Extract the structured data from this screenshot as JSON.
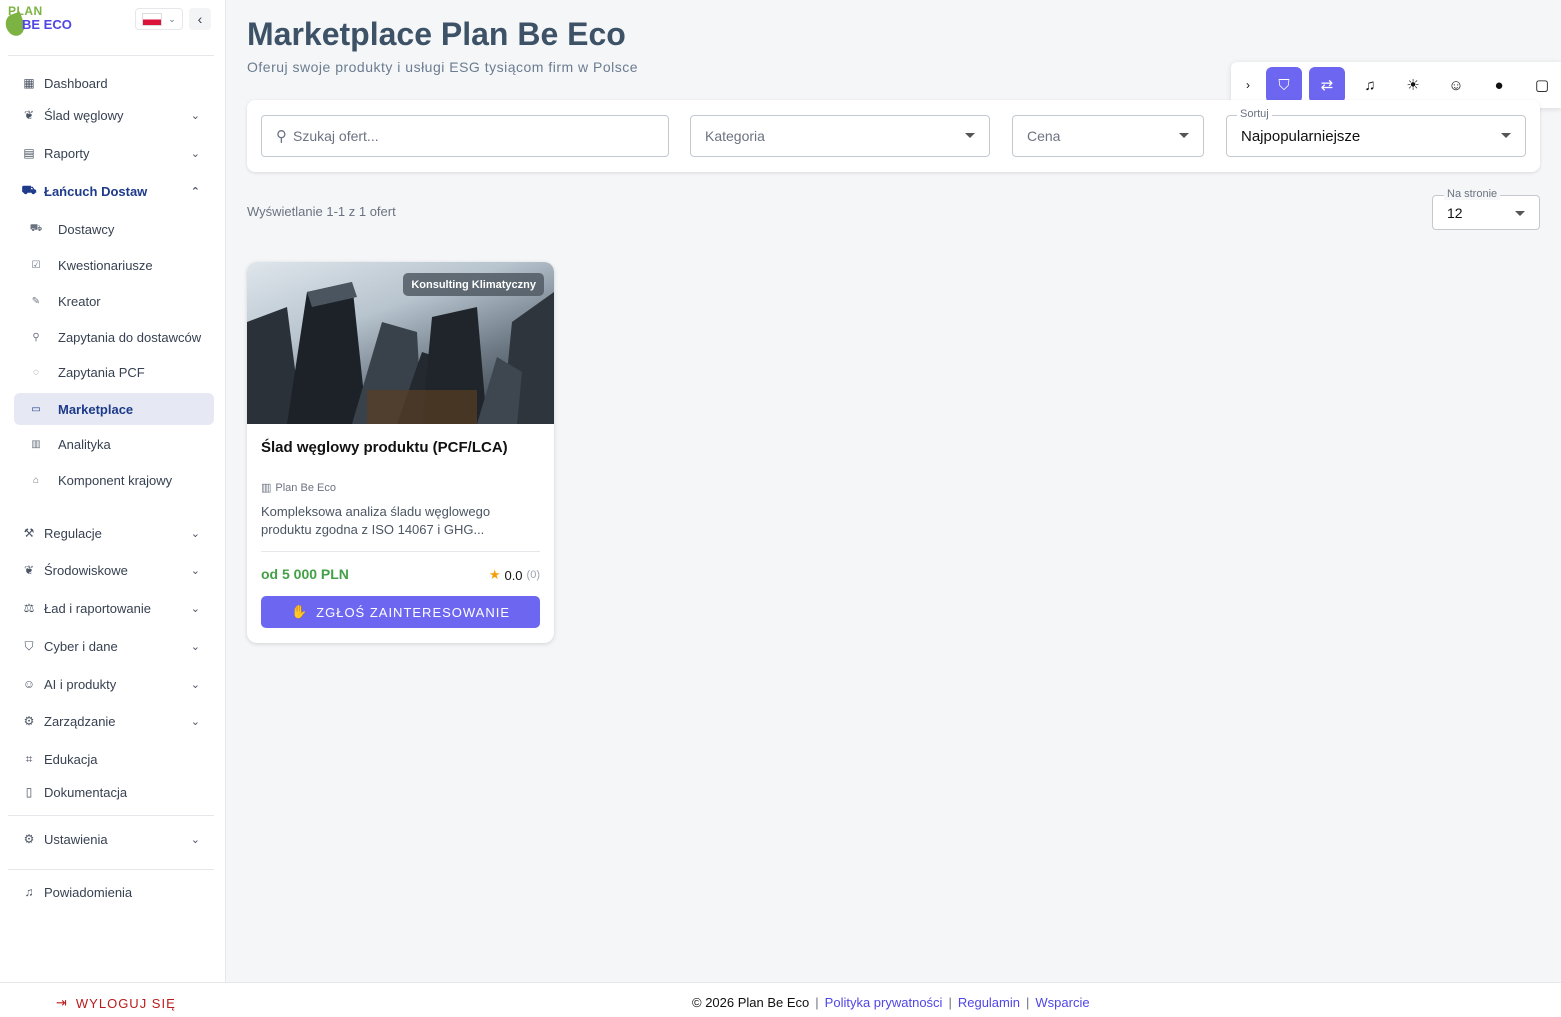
{
  "brand": {
    "line1": "PLAN",
    "line2": "BE ECO"
  },
  "sidebar": {
    "items": [
      {
        "icon": "dashboard-icon",
        "label": "Dashboard"
      },
      {
        "icon": "leaf-icon",
        "label": "Ślad węglowy"
      },
      {
        "icon": "report-icon",
        "label": "Raporty"
      },
      {
        "icon": "truck-icon",
        "label": "Łańcuch Dostaw"
      },
      {
        "icon": "truck-icon",
        "label": "Dostawcy"
      },
      {
        "icon": "checklist-icon",
        "label": "Kwestionariusze"
      },
      {
        "icon": "edit-icon",
        "label": "Kreator"
      },
      {
        "icon": "user-request-icon",
        "label": "Zapytania do dostawców"
      },
      {
        "icon": "co2-icon",
        "label": "Zapytania PCF"
      },
      {
        "icon": "store-icon",
        "label": "Marketplace"
      },
      {
        "icon": "bar-chart-icon",
        "label": "Analityka"
      },
      {
        "icon": "home-icon",
        "label": "Komponent krajowy"
      },
      {
        "icon": "gavel-icon",
        "label": "Regulacje"
      },
      {
        "icon": "leaf-icon",
        "label": "Środowiskowe"
      },
      {
        "icon": "scale-icon",
        "label": "Ład i raportowanie"
      },
      {
        "icon": "shield-icon",
        "label": "Cyber i dane"
      },
      {
        "icon": "robot-icon",
        "label": "AI i produkty"
      },
      {
        "icon": "gear-icon",
        "label": "Zarządzanie"
      },
      {
        "icon": "graduation-cap-icon",
        "label": "Edukacja"
      },
      {
        "icon": "book-icon",
        "label": "Dokumentacja"
      },
      {
        "icon": "gear-icon",
        "label": "Ustawienia"
      },
      {
        "icon": "bell-icon",
        "label": "Powiadomienia"
      }
    ]
  },
  "page": {
    "title": "Marketplace Plan Be Eco",
    "subtitle": "Oferuj swoje produkty i usługi ESG tysiącom firm w Polsce"
  },
  "filters": {
    "search_placeholder": "Szukaj ofert...",
    "category_placeholder": "Kategoria",
    "price_placeholder": "Cena",
    "sort_label": "Sortuj",
    "sort_value": "Najpopularniejsze"
  },
  "results": {
    "count_text": "Wyświetlanie 1-1 z 1 ofert",
    "per_page_label": "Na stronie",
    "per_page_value": "12"
  },
  "offer": {
    "category": "Konsulting Klimatyczny",
    "title": "Ślad węglowy produktu (PCF/LCA)",
    "provider": "Plan Be Eco",
    "description": "Kompleksowa analiza śladu węglowego produktu zgodna z ISO 14067 i GHG...",
    "price": "od 5 000 PLN",
    "rating": "0.0",
    "rating_count": "(0)",
    "button": "ZGŁOŚ ZAINTERESOWANIE"
  },
  "footer": {
    "logout": "WYLOGUJ SIĘ",
    "copyright": "© 2026 Plan Be Eco",
    "privacy": "Polityka prywatności",
    "terms": "Regulamin",
    "support": "Wsparcie"
  },
  "colors": {
    "accent": "#6d66f0",
    "brand_green": "#7cb342",
    "nav_active": "#1e3a8a",
    "price_green": "#43a047",
    "logout_red": "#b91c1c"
  }
}
